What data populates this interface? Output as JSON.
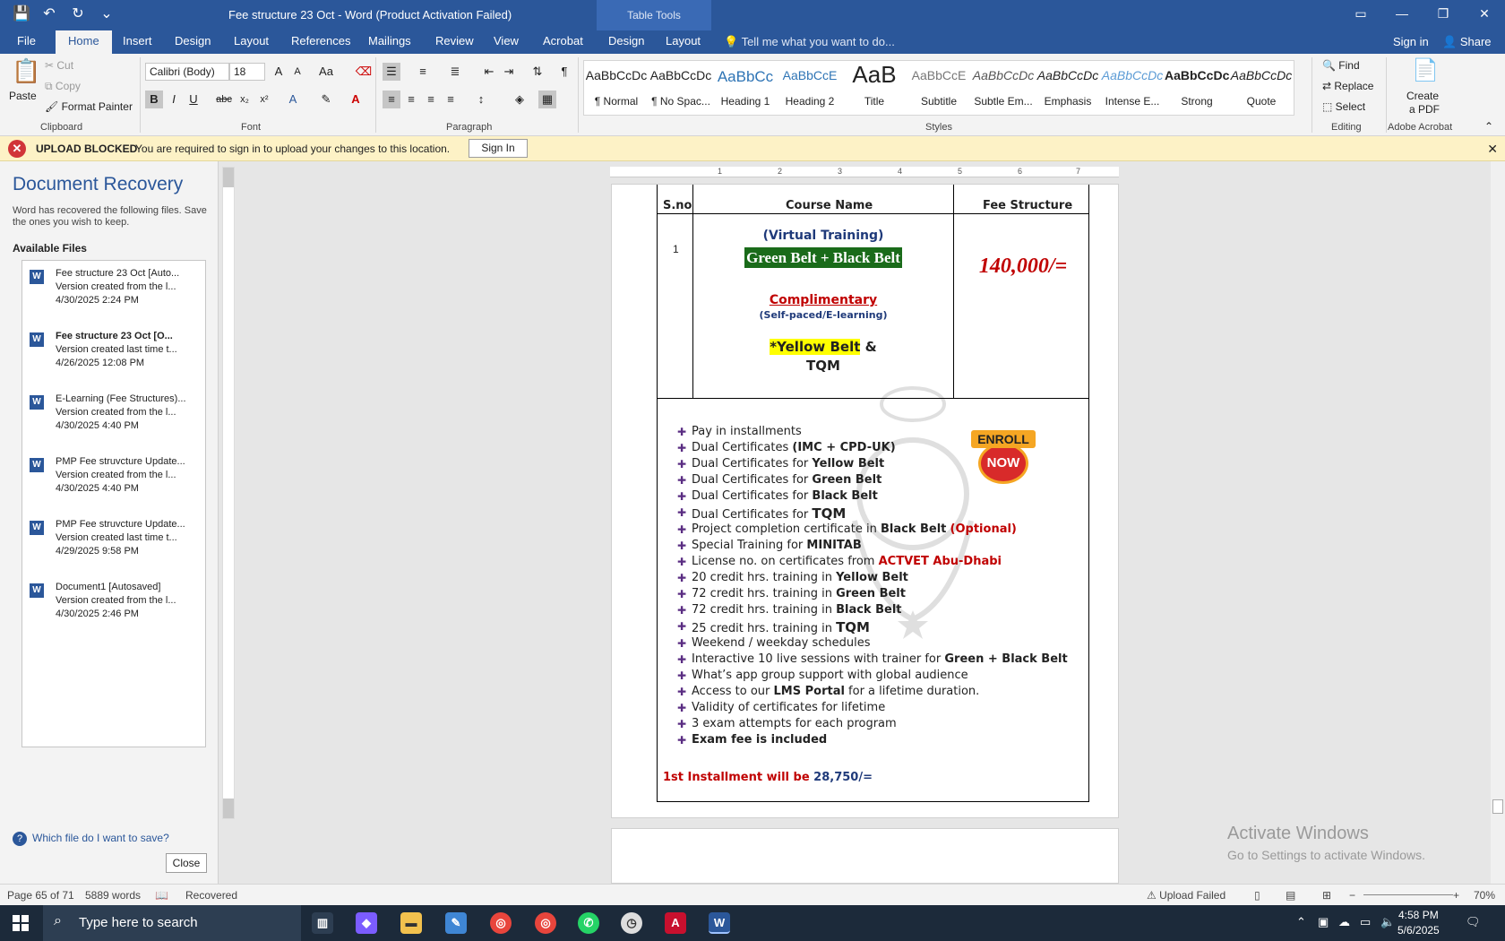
{
  "window": {
    "title": "Fee structure 23 Oct - Word (Product Activation Failed)",
    "table_tools": "Table Tools",
    "controls": [
      "▭",
      "—",
      "❐",
      "✕"
    ]
  },
  "qat": {
    "save": "💾",
    "undo": "↶",
    "redo": "↻",
    "more": "⌄"
  },
  "tabs": {
    "file": "File",
    "home": "Home",
    "insert": "Insert",
    "design": "Design",
    "layout": "Layout",
    "references": "References",
    "mailings": "Mailings",
    "review": "Review",
    "view": "View",
    "acrobat": "Acrobat",
    "table_design": "Design",
    "table_layout": "Layout",
    "tell_me": "Tell me what you want to do...",
    "sign_in": "Sign in",
    "share": "Share"
  },
  "ribbon": {
    "clipboard": {
      "paste": "Paste",
      "cut": "Cut",
      "copy": "Copy",
      "format_painter": "Format Painter",
      "label": "Clipboard"
    },
    "font": {
      "name": "Calibri (Body)",
      "size": "18",
      "label": "Font"
    },
    "paragraph": {
      "label": "Paragraph"
    },
    "styles": {
      "label": "Styles",
      "items": [
        {
          "preview": "AaBbCcDc",
          "name": "¶ Normal"
        },
        {
          "preview": "AaBbCcDc",
          "name": "¶ No Spac..."
        },
        {
          "preview": "AaBbCc",
          "name": "Heading 1"
        },
        {
          "preview": "AaBbCcE",
          "name": "Heading 2"
        },
        {
          "preview": "AaB",
          "name": "Title"
        },
        {
          "preview": "AaBbCcE",
          "name": "Subtitle"
        },
        {
          "preview": "AaBbCcDc",
          "name": "Subtle Em..."
        },
        {
          "preview": "AaBbCcDc",
          "name": "Emphasis"
        },
        {
          "preview": "AaBbCcDc",
          "name": "Intense E..."
        },
        {
          "preview": "AaBbCcDc",
          "name": "Strong"
        },
        {
          "preview": "AaBbCcDc",
          "name": "Quote"
        }
      ]
    },
    "editing": {
      "find": "Find",
      "replace": "Replace",
      "select": "Select",
      "label": "Editing"
    },
    "acrobat": {
      "create": "Create",
      "pdf": "a PDF",
      "label": "Adobe Acrobat"
    }
  },
  "message_bar": {
    "title": "UPLOAD BLOCKED",
    "text": "You are required to sign in to upload your changes to this location.",
    "button": "Sign In"
  },
  "recovery": {
    "title": "Document Recovery",
    "desc": "Word has recovered the following files. Save the ones you wish to keep.",
    "available": "Available Files",
    "files": [
      {
        "name": "Fee structure 23 Oct  [Auto...",
        "line2": "Version created from the l...",
        "date": "4/30/2025 2:24 PM"
      },
      {
        "name": "Fee structure 23 Oct  [O...",
        "line2": "Version created last time t...",
        "date": "4/26/2025 12:08 PM"
      },
      {
        "name": "E-Learning (Fee Structures)...",
        "line2": "Version created from the l...",
        "date": "4/30/2025 4:40 PM"
      },
      {
        "name": "PMP Fee struvcture Update...",
        "line2": "Version created from the l...",
        "date": "4/30/2025 4:40 PM"
      },
      {
        "name": "PMP Fee struvcture Update...",
        "line2": "Version created last time t...",
        "date": "4/29/2025 9:58 PM"
      },
      {
        "name": "Document1  [Autosaved]",
        "line2": "Version created from the l...",
        "date": "4/30/2025 2:46 PM"
      }
    ],
    "help": "Which file do I want to save?",
    "close": "Close"
  },
  "document": {
    "headers": {
      "sno": "S.no",
      "course": "Course Name",
      "fee": "Fee Structure"
    },
    "sno_value": "1",
    "virtual": "(Virtual Training)",
    "belts": "Green Belt + Black Belt",
    "fee": "140,000/=",
    "complimentary": "Complimentary",
    "self_paced": "(Self-paced/E-learning)",
    "yellow_belt": "*Yellow Belt",
    "amp": " &",
    "tqm": "TQM",
    "enroll_top": "ENROLL",
    "enroll_now": "NOW",
    "bullets": [
      {
        "pre": "Pay in installments",
        "bold": "",
        "post": "",
        "red": ""
      },
      {
        "pre": "Dual Certificates ",
        "bold": "(IMC + CPD-UK)",
        "post": "",
        "red": ""
      },
      {
        "pre": "Dual Certificates for ",
        "bold": "Yellow Belt",
        "post": "",
        "red": ""
      },
      {
        "pre": "Dual Certificates for ",
        "bold": "Green Belt",
        "post": "",
        "red": ""
      },
      {
        "pre": "Dual Certificates for ",
        "bold": "Black Belt",
        "post": "",
        "red": ""
      },
      {
        "pre": "Dual Certificates for  ",
        "bold": "TQM",
        "post": "",
        "red": ""
      },
      {
        "pre": " Project completion certificate in ",
        "bold": "Black Belt",
        "post": " ",
        "red": "(Optional)"
      },
      {
        "pre": "Special Training for ",
        "bold": "MINITAB",
        "post": "",
        "red": ""
      },
      {
        "pre": "License no. on certificates from ",
        "bold": "",
        "post": "",
        "red": "ACTVET Abu-Dhabi"
      },
      {
        "pre": "20 credit hrs. training in ",
        "bold": "Yellow Belt",
        "post": "",
        "red": ""
      },
      {
        "pre": "72 credit hrs. training in ",
        "bold": "Green Belt",
        "post": "",
        "red": ""
      },
      {
        "pre": "72 credit hrs. training in ",
        "bold": "Black Belt",
        "post": "",
        "red": ""
      },
      {
        "pre": "25 credit hrs. training in  ",
        "bold": "TQM",
        "post": "",
        "red": ""
      },
      {
        "pre": " Weekend / weekday schedules",
        "bold": "",
        "post": "",
        "red": ""
      },
      {
        "pre": "Interactive 10 live sessions with trainer for ",
        "bold": "Green + Black Belt",
        "post": "",
        "red": ""
      },
      {
        "pre": "What’s app group support with global audience",
        "bold": "",
        "post": "",
        "red": ""
      },
      {
        "pre": "Access to our ",
        "bold": "LMS Portal",
        "post": " for a lifetime duration.",
        "red": ""
      },
      {
        "pre": "Validity of certificates for lifetime",
        "bold": "",
        "post": "",
        "red": ""
      },
      {
        "pre": "3 exam attempts for each program",
        "bold": "",
        "post": "",
        "red": ""
      },
      {
        "pre": "",
        "bold": "Exam fee is included",
        "post": "",
        "red": ""
      }
    ],
    "installment_label": "1st Installment will be ",
    "installment_value": "28,750/="
  },
  "activate": {
    "line1": "Activate Windows",
    "line2": "Go to Settings to activate Windows."
  },
  "status": {
    "page": "Page 65 of 71",
    "words": "5889 words",
    "recovered": "Recovered",
    "upload": "Upload Failed",
    "zoom": "70%"
  },
  "taskbar": {
    "search_placeholder": "Type here to search",
    "time": "4:58 PM",
    "date": "5/6/2025"
  }
}
